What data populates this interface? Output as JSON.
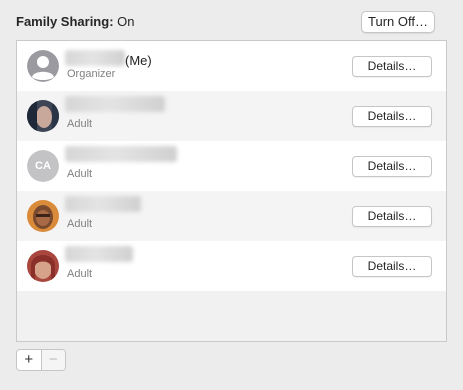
{
  "header": {
    "label": "Family Sharing:",
    "status": "On",
    "turn_off_label": "Turn Off…"
  },
  "members": [
    {
      "suffix": "(Me)",
      "role": "Organizer",
      "details_label": "Details…",
      "avatar": "generic-person-icon"
    },
    {
      "suffix": "",
      "role": "Adult",
      "details_label": "Details…",
      "avatar": "photo"
    },
    {
      "suffix": "",
      "role": "Adult",
      "details_label": "Details…",
      "avatar": "initials",
      "initials": "CA"
    },
    {
      "suffix": "",
      "role": "Adult",
      "details_label": "Details…",
      "avatar": "photo"
    },
    {
      "suffix": "",
      "role": "Adult",
      "details_label": "Details…",
      "avatar": "photo"
    }
  ],
  "footer": {
    "add_label": "+",
    "remove_label": "−"
  }
}
